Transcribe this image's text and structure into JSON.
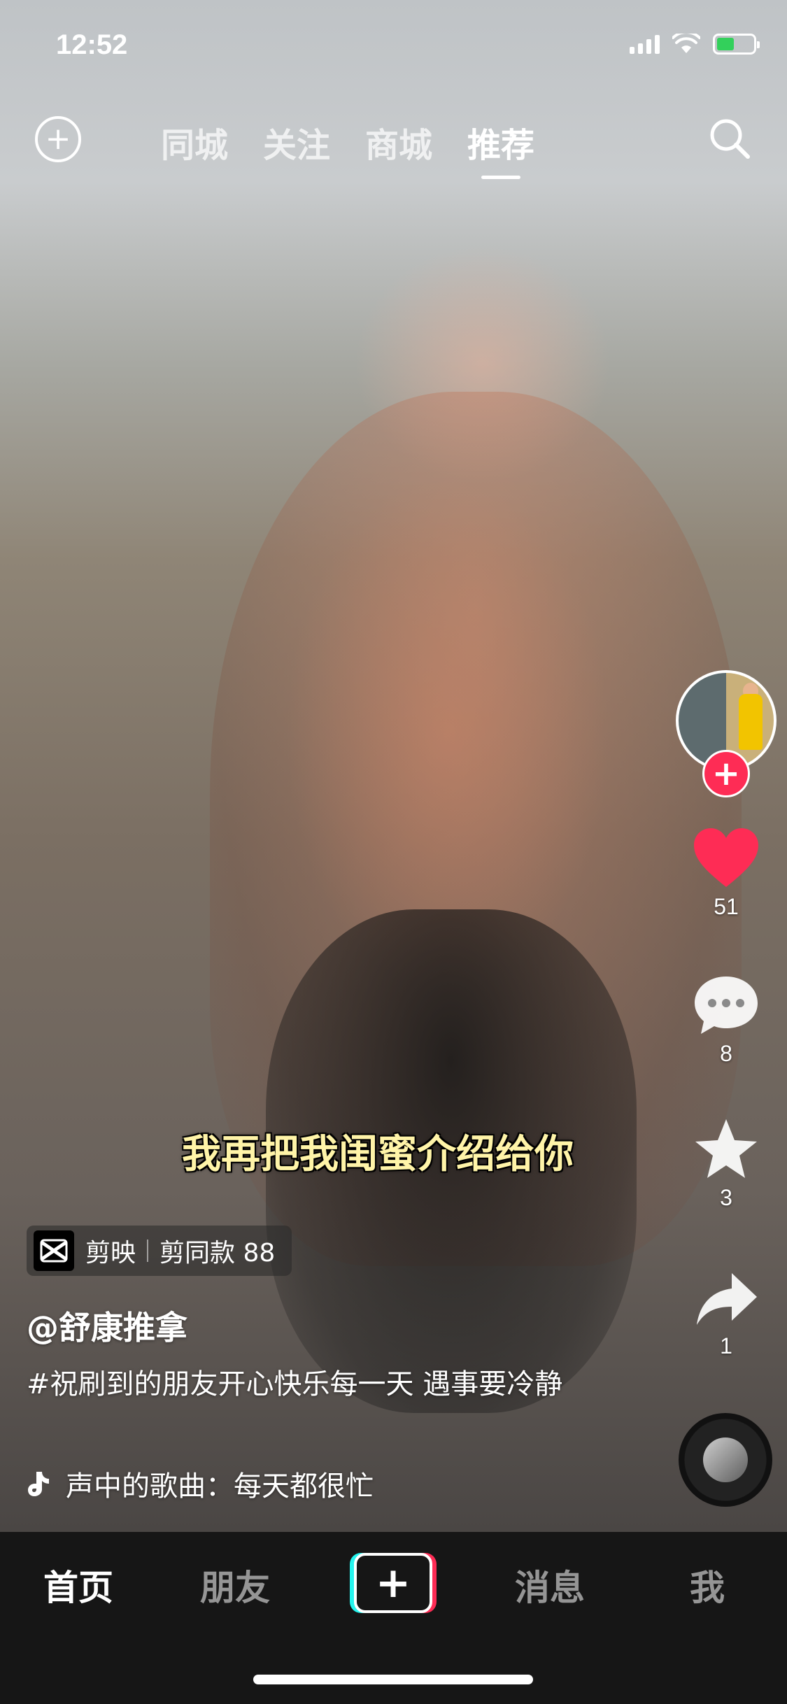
{
  "status_bar": {
    "time": "12:52"
  },
  "top_nav": {
    "tabs": [
      {
        "label": "同城",
        "active": false
      },
      {
        "label": "关注",
        "active": false
      },
      {
        "label": "商城",
        "active": false
      },
      {
        "label": "推荐",
        "active": true
      }
    ]
  },
  "video": {
    "caption": "我再把我闺蜜介绍给你"
  },
  "actions": {
    "likes": "51",
    "comments": "8",
    "favorites": "3",
    "shares": "1"
  },
  "info": {
    "capcut_app": "剪映",
    "capcut_template": "剪同款 88",
    "username": "@舒康推拿",
    "description": "#祝刷到的朋友开心快乐每一天 遇事要冷静",
    "music": "声中的歌曲：每天都很忙"
  },
  "tabbar": {
    "items": [
      {
        "label": "首页",
        "active": true
      },
      {
        "label": "朋友",
        "active": false
      },
      {
        "label": "消息",
        "active": false
      },
      {
        "label": "我",
        "active": false
      }
    ]
  },
  "colors": {
    "accent": "#fe2c55",
    "cyan": "#25f4ee",
    "caption": "#fff4a8"
  },
  "icons": [
    "plus-circle-icon",
    "search-icon",
    "heart-icon",
    "comment-icon",
    "star-icon",
    "share-icon",
    "music-note-icon",
    "capcut-icon"
  ]
}
